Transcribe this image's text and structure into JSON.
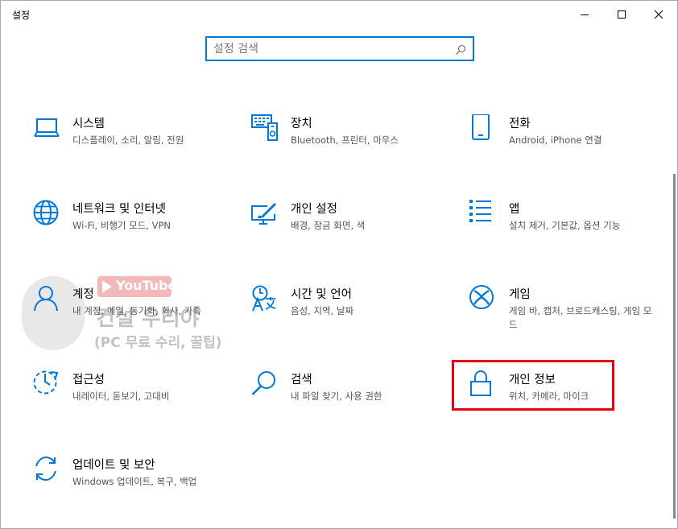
{
  "window": {
    "title": "설정",
    "minimize_icon": "minimize-icon",
    "maximize_icon": "maximize-icon",
    "close_icon": "close-icon"
  },
  "search": {
    "placeholder": "설정 검색",
    "value": "",
    "icon": "search-icon"
  },
  "categories": [
    {
      "title": "시스템",
      "desc": "디스플레이, 소리, 알림, 전원",
      "icon": "laptop-icon"
    },
    {
      "title": "장치",
      "desc": "Bluetooth, 프린터, 마우스",
      "icon": "devices-icon"
    },
    {
      "title": "전화",
      "desc": "Android, iPhone 연결",
      "icon": "phone-icon"
    },
    {
      "title": "네트워크 및 인터넷",
      "desc": "Wi-Fi, 비행기 모드, VPN",
      "icon": "globe-icon"
    },
    {
      "title": "개인 설정",
      "desc": "배경, 잠금 화면, 색",
      "icon": "personalization-icon"
    },
    {
      "title": "앱",
      "desc": "설치 제거, 기본값, 옵션 기능",
      "icon": "apps-list-icon"
    },
    {
      "title": "계정",
      "desc": "내 계정, 메일, 동기화, 회사, 가족",
      "icon": "person-icon"
    },
    {
      "title": "시간 및 언어",
      "desc": "음성, 지역, 날짜",
      "icon": "time-language-icon"
    },
    {
      "title": "게임",
      "desc": "게임 바, 캡처, 브로드캐스팅, 게임 모드",
      "icon": "xbox-icon"
    },
    {
      "title": "접근성",
      "desc": "내레이터, 돋보기, 고대비",
      "icon": "ease-of-access-icon"
    },
    {
      "title": "검색",
      "desc": "내 파일 찾기, 사용 권한",
      "icon": "search-icon"
    },
    {
      "title": "개인 정보",
      "desc": "위치, 카메라, 마이크",
      "icon": "lock-icon"
    },
    {
      "title": "업데이트 및 보안",
      "desc": "Windows 업데이트, 복구, 백업",
      "icon": "update-sync-icon"
    }
  ],
  "watermark": {
    "brand": "YouTube",
    "name": "컨설 우리야",
    "subtitle": "(PC 무료 수리, 꿀팁)"
  },
  "colors": {
    "accent": "#0078d7",
    "highlight_box": "#e60012"
  }
}
